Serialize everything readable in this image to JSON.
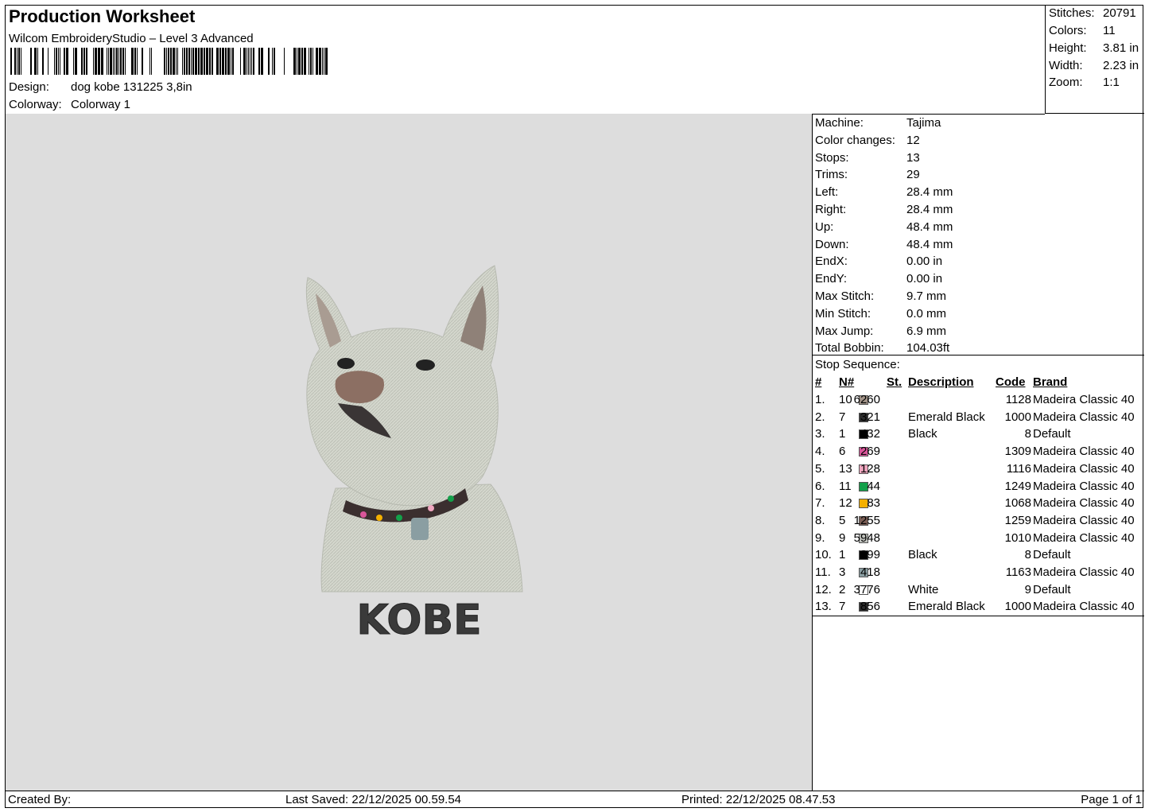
{
  "header": {
    "title": "Production Worksheet",
    "subtitle": "Wilcom EmbroideryStudio – Level 3 Advanced",
    "design_label": "Design:",
    "design_value": "dog kobe  131225 3,8in",
    "colorway_label": "Colorway:",
    "colorway_value": "Colorway 1"
  },
  "stats": [
    {
      "label": "Stitches:",
      "value": "20791"
    },
    {
      "label": "Colors:",
      "value": "11"
    },
    {
      "label": "Height:",
      "value": "3.81 in"
    },
    {
      "label": "Width:",
      "value": "2.23 in"
    },
    {
      "label": "Zoom:",
      "value": "1:1"
    }
  ],
  "design": {
    "text": "KOBE",
    "fill_color": "#d2d6cc",
    "name_color": "#3a3a3a"
  },
  "machine_info": [
    {
      "label": "Machine:",
      "value": "Tajima"
    },
    {
      "label": "Color changes:",
      "value": "12"
    },
    {
      "label": "Stops:",
      "value": "13"
    },
    {
      "label": "Trims:",
      "value": "29"
    },
    {
      "label": "Left:",
      "value": "28.4 mm"
    },
    {
      "label": "Right:",
      "value": "28.4 mm"
    },
    {
      "label": "Up:",
      "value": "48.4 mm"
    },
    {
      "label": "Down:",
      "value": "48.4 mm"
    },
    {
      "label": "EndX:",
      "value": "0.00 in"
    },
    {
      "label": "EndY:",
      "value": "0.00 in"
    },
    {
      "label": "Max Stitch:",
      "value": "9.7 mm"
    },
    {
      "label": "Min Stitch:",
      "value": "0.0 mm"
    },
    {
      "label": "Max Jump:",
      "value": "6.9 mm"
    },
    {
      "label": "Total Bobbin:",
      "value": "104.03ft"
    }
  ],
  "sequence": {
    "title": "Stop Sequence:",
    "headers": {
      "num": "#",
      "n": "N#",
      "st": "St.",
      "desc": "Description",
      "code": "Code",
      "brand": "Brand"
    },
    "rows": [
      {
        "num": "1.",
        "n": "10",
        "color": "#a39489",
        "st": "6260",
        "desc": "",
        "code": "1128",
        "brand": "Madeira Classic 40"
      },
      {
        "num": "2.",
        "n": "7",
        "color": "#2b2b2b",
        "st": "321",
        "desc": "Emerald Black",
        "code": "1000",
        "brand": "Madeira Classic 40"
      },
      {
        "num": "3.",
        "n": "1",
        "color": "#000000",
        "st": "432",
        "desc": "Black",
        "code": "8",
        "brand": "Default"
      },
      {
        "num": "4.",
        "n": "6",
        "color": "#d9569a",
        "st": "269",
        "desc": "",
        "code": "1309",
        "brand": "Madeira Classic 40"
      },
      {
        "num": "5.",
        "n": "13",
        "color": "#f0a7c0",
        "st": "128",
        "desc": "",
        "code": "1116",
        "brand": "Madeira Classic 40"
      },
      {
        "num": "6.",
        "n": "11",
        "color": "#13a04a",
        "st": "44",
        "desc": "",
        "code": "1249",
        "brand": "Madeira Classic 40"
      },
      {
        "num": "7.",
        "n": "12",
        "color": "#f5b000",
        "st": "83",
        "desc": "",
        "code": "1068",
        "brand": "Madeira Classic 40"
      },
      {
        "num": "8.",
        "n": "5",
        "color": "#7a5e55",
        "st": "1255",
        "desc": "",
        "code": "1259",
        "brand": "Madeira Classic 40"
      },
      {
        "num": "9.",
        "n": "9",
        "color": "#c2c4bf",
        "st": "5948",
        "desc": "",
        "code": "1010",
        "brand": "Madeira Classic 40"
      },
      {
        "num": "10.",
        "n": "1",
        "color": "#000000",
        "st": "999",
        "desc": "Black",
        "code": "8",
        "brand": "Default"
      },
      {
        "num": "11.",
        "n": "3",
        "color": "#8a9ea2",
        "st": "418",
        "desc": "",
        "code": "1163",
        "brand": "Madeira Classic 40"
      },
      {
        "num": "12.",
        "n": "2",
        "color": "#ffffff",
        "st": "3776",
        "desc": "White",
        "code": "9",
        "brand": "Default"
      },
      {
        "num": "13.",
        "n": "7",
        "color": "#2b2b2b",
        "st": "856",
        "desc": "Emerald Black",
        "code": "1000",
        "brand": "Madeira Classic 40"
      }
    ]
  },
  "footer": {
    "created_by": "Created By:",
    "last_saved": "Last Saved: 22/12/2025 00.59.54",
    "printed": "Printed: 22/12/2025 08.47.53",
    "page": "Page 1 of 1"
  }
}
